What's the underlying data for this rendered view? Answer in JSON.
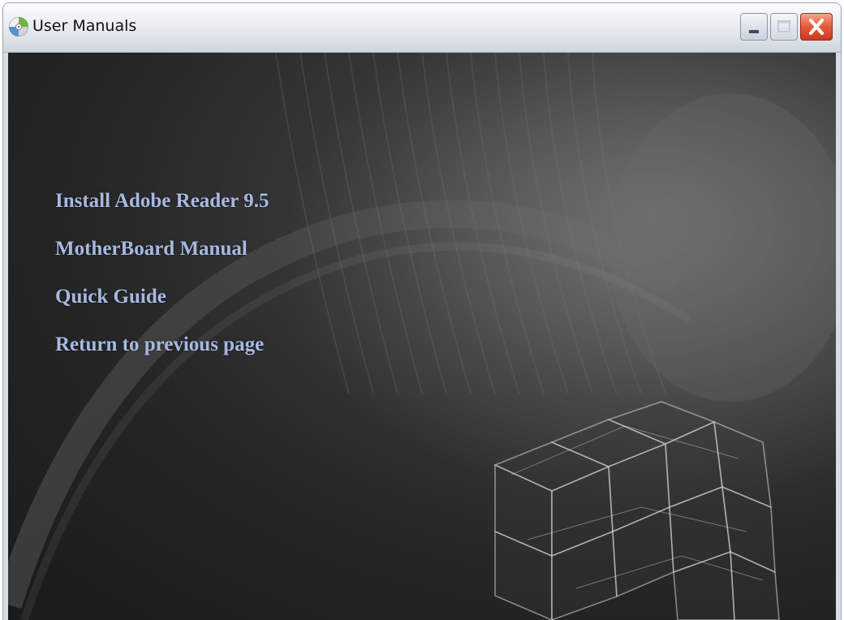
{
  "window": {
    "title": "User Manuals",
    "icon": "cd-disc-icon",
    "controls": {
      "minimize_icon": "minimize-icon",
      "maximize_icon": "maximize-icon",
      "close_icon": "close-icon",
      "close_color": "#e35b3c"
    }
  },
  "menu": {
    "items": [
      {
        "label": "Install Adobe Reader 9.5"
      },
      {
        "label": "MotherBoard Manual"
      },
      {
        "label": "Quick Guide"
      },
      {
        "label": "Return to previous page"
      }
    ],
    "link_color": "#a7b8e2"
  },
  "background": {
    "theme": "dark-abstract-wireframe-cube",
    "base_color": "#1a1a1a"
  }
}
